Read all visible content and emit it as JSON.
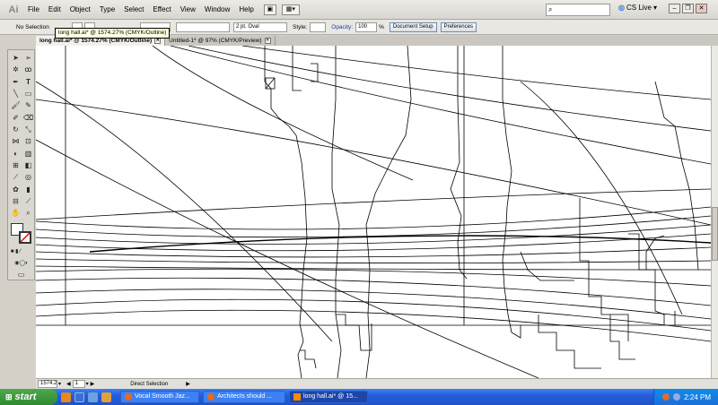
{
  "app": {
    "logo": "Ai",
    "menus": [
      "File",
      "Edit",
      "Object",
      "Type",
      "Select",
      "Effect",
      "View",
      "Window",
      "Help"
    ],
    "search_placeholder": "",
    "cs_live": "CS Live"
  },
  "control_bar": {
    "selection": "No Selection",
    "brush": "2 pt. Oval",
    "style_label": "Style:",
    "opacity_label": "Opacity:",
    "opacity_value": "100",
    "opacity_unit": "%",
    "document_setup": "Document Setup",
    "preferences": "Preferences"
  },
  "tooltip": "long hall.ai* @ 1574.27% (CMYK/Outline)",
  "tabs": [
    {
      "label": "long hall.ai* @ 1574.27% (CMYK/Outline)",
      "active": true
    },
    {
      "label": "Untitled-1* @ 97% (CMYK/Preview)",
      "active": false
    }
  ],
  "status_bar": {
    "zoom": "1574.2",
    "page": "1",
    "tool": "Direct Selection"
  },
  "taskbar": {
    "start": "start",
    "tasks": [
      {
        "label": "Vocal Smooth Jaz...",
        "icon_color": "#e86a1a"
      },
      {
        "label": "Architects should ...",
        "icon_color": "#e86a1a"
      },
      {
        "label": "long hall.ai* @ 15...",
        "icon_color": "#ff8a00",
        "active": true
      }
    ],
    "clock": "2:24 PM"
  }
}
